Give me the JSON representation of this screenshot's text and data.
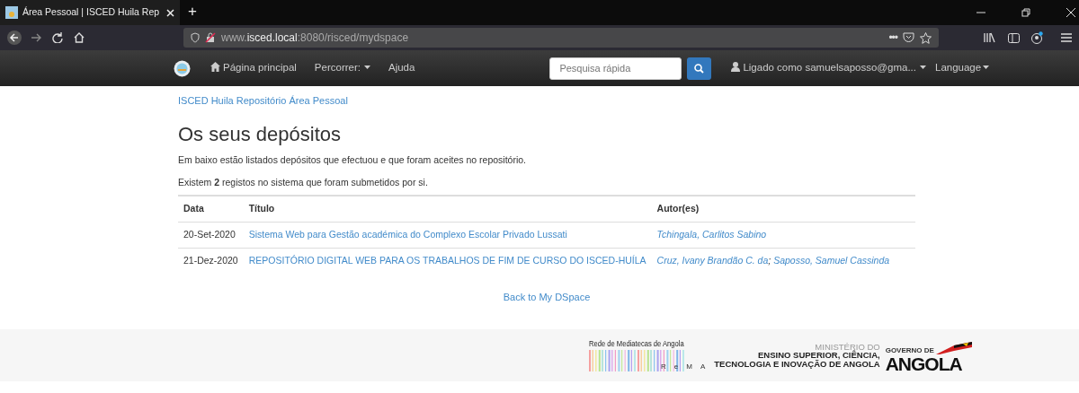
{
  "browser": {
    "tab_title": "Área Pessoal | ISCED Huila Rep",
    "new_tab": "+",
    "url_prefix": "www.",
    "url_host": "isced.local",
    "url_rest": ":8080/risced/mydspace",
    "more": "•••"
  },
  "navbar": {
    "items": [
      {
        "label": "Página principal",
        "kind": "home"
      },
      {
        "label": "Percorrer:",
        "kind": "dropdown"
      },
      {
        "label": "Ajuda",
        "kind": "link"
      }
    ],
    "search": {
      "placeholder": "Pesquisa rápida"
    },
    "user": "Ligado como samuelsaposso@gma...",
    "language": "Language"
  },
  "breadcrumb": "ISCED Huila Repositório Área Pessoal",
  "heading": "Os seus depósitos",
  "intro": "Em baixo estão listados depósitos que efectuou e que foram aceites no repositório.",
  "count_text": "Existem **2** registos no sistema que foram submetidos por si.",
  "table": {
    "columns": [
      "Data",
      "Título",
      "Autor(es)"
    ],
    "rows": [
      {
        "date": "20-Set-2020",
        "title": "Sistema Web para Gestão académica do Complexo Escolar Privado Lussati",
        "authors": [
          "Tchingala, Carlitos Sabino"
        ]
      },
      {
        "date": "21-Dez-2020",
        "title": "REPOSITÓRIO DIGITAL WEB PARA OS TRABALHOS DE FIM DE CURSO DO ISCED-HUÍLA",
        "authors": [
          "Cruz, Ivany Brandão C. da",
          "Saposso, Samuel Cassinda"
        ]
      }
    ],
    "author_separator": ";"
  },
  "back_link": "Back to My DSpace",
  "footer": {
    "rema_title": "Rede de Mediatecas de Angola",
    "rema_letters": [
      "R",
      "e",
      "M",
      "A"
    ],
    "ministry_top": "MINISTÉRIO DO",
    "ministry_line2": "ENSINO SUPERIOR, CIÊNCIA,",
    "ministry_line3": "TECNOLOGIA E INOVAÇÃO DE ANGOLA",
    "gov_small": "GOVERNO DE",
    "gov_big": "ANGOLA"
  }
}
